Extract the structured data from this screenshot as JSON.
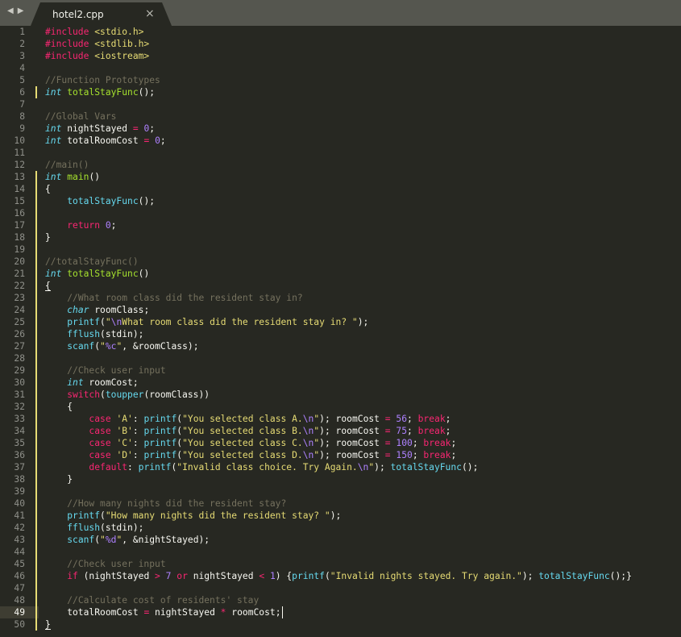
{
  "nav": {
    "back_icon": "left-triangle",
    "forward_icon": "right-triangle"
  },
  "tab": {
    "title": "hotel2.cpp",
    "close_glyph": "×"
  },
  "editor": {
    "cursor_line": 49,
    "modified_lines": [
      6,
      13,
      14,
      15,
      16,
      17,
      18,
      19,
      20,
      21,
      22,
      23,
      24,
      25,
      26,
      27,
      28,
      29,
      30,
      31,
      32,
      33,
      34,
      35,
      36,
      37,
      38,
      39,
      40,
      41,
      42,
      43,
      44,
      45,
      46,
      47,
      48,
      49,
      50
    ],
    "colors": {
      "background": "#272822",
      "tabbar": "#55564f",
      "foreground": "#f8f8f2",
      "keyword": "#f92672",
      "comment": "#75715e",
      "type": "#66d9ef",
      "function": "#a6e22e",
      "string": "#e6db74",
      "number": "#ae81ff"
    },
    "lines": [
      [
        [
          "pre",
          "#include "
        ],
        [
          "str",
          "<stdio.h>"
        ]
      ],
      [
        [
          "pre",
          "#include "
        ],
        [
          "str",
          "<stdlib.h>"
        ]
      ],
      [
        [
          "pre",
          "#include "
        ],
        [
          "str",
          "<iostream>"
        ]
      ],
      [],
      [
        [
          "com",
          "//Function Prototypes"
        ]
      ],
      [
        [
          "type",
          "int"
        ],
        [
          "op",
          " "
        ],
        [
          "fn",
          "totalStayFunc"
        ],
        [
          "op",
          "();"
        ]
      ],
      [],
      [
        [
          "com",
          "//Global Vars"
        ]
      ],
      [
        [
          "type",
          "int"
        ],
        [
          "op",
          " nightStayed "
        ],
        [
          "kw",
          "="
        ],
        [
          "op",
          " "
        ],
        [
          "num",
          "0"
        ],
        [
          "op",
          ";"
        ]
      ],
      [
        [
          "type",
          "int"
        ],
        [
          "op",
          " totalRoomCost "
        ],
        [
          "kw",
          "="
        ],
        [
          "op",
          " "
        ],
        [
          "num",
          "0"
        ],
        [
          "op",
          ";"
        ]
      ],
      [],
      [
        [
          "com",
          "//main()"
        ]
      ],
      [
        [
          "type",
          "int"
        ],
        [
          "op",
          " "
        ],
        [
          "fn",
          "main"
        ],
        [
          "op",
          "()"
        ]
      ],
      [
        [
          "op",
          "{"
        ]
      ],
      [
        [
          "op",
          "    "
        ],
        [
          "lib",
          "totalStayFunc"
        ],
        [
          "op",
          "();"
        ]
      ],
      [],
      [
        [
          "op",
          "    "
        ],
        [
          "kw",
          "return"
        ],
        [
          "op",
          " "
        ],
        [
          "num",
          "0"
        ],
        [
          "op",
          ";"
        ]
      ],
      [
        [
          "op",
          "}"
        ]
      ],
      [],
      [
        [
          "com",
          "//totalStayFunc()"
        ]
      ],
      [
        [
          "type",
          "int"
        ],
        [
          "op",
          " "
        ],
        [
          "fn",
          "totalStayFunc"
        ],
        [
          "op",
          "()"
        ]
      ],
      [
        [
          "op",
          "{"
        ]
      ],
      [
        [
          "op",
          "    "
        ],
        [
          "com",
          "//What room class did the resident stay in?"
        ]
      ],
      [
        [
          "op",
          "    "
        ],
        [
          "type",
          "char"
        ],
        [
          "op",
          " roomClass;"
        ]
      ],
      [
        [
          "op",
          "    "
        ],
        [
          "lib",
          "printf"
        ],
        [
          "op",
          "("
        ],
        [
          "str",
          "\""
        ],
        [
          "esc",
          "\\n"
        ],
        [
          "str",
          "What room class did the resident stay in? \""
        ],
        [
          "op",
          ");"
        ]
      ],
      [
        [
          "op",
          "    "
        ],
        [
          "lib",
          "fflush"
        ],
        [
          "op",
          "(stdin);"
        ]
      ],
      [
        [
          "op",
          "    "
        ],
        [
          "lib",
          "scanf"
        ],
        [
          "op",
          "("
        ],
        [
          "str",
          "\""
        ],
        [
          "esc",
          "%c"
        ],
        [
          "str",
          "\""
        ],
        [
          "op",
          ", &roomClass);"
        ]
      ],
      [],
      [
        [
          "op",
          "    "
        ],
        [
          "com",
          "//Check user input"
        ]
      ],
      [
        [
          "op",
          "    "
        ],
        [
          "type",
          "int"
        ],
        [
          "op",
          " roomCost;"
        ]
      ],
      [
        [
          "op",
          "    "
        ],
        [
          "kw",
          "switch"
        ],
        [
          "op",
          "("
        ],
        [
          "lib",
          "toupper"
        ],
        [
          "op",
          "(roomClass))"
        ]
      ],
      [
        [
          "op",
          "    {"
        ]
      ],
      [
        [
          "op",
          "        "
        ],
        [
          "kw",
          "case"
        ],
        [
          "op",
          " "
        ],
        [
          "str",
          "'A'"
        ],
        [
          "op",
          ": "
        ],
        [
          "lib",
          "printf"
        ],
        [
          "op",
          "("
        ],
        [
          "str",
          "\"You selected class A."
        ],
        [
          "esc",
          "\\n"
        ],
        [
          "str",
          "\""
        ],
        [
          "op",
          "); roomCost "
        ],
        [
          "kw",
          "="
        ],
        [
          "op",
          " "
        ],
        [
          "num",
          "56"
        ],
        [
          "op",
          "; "
        ],
        [
          "kw",
          "break"
        ],
        [
          "op",
          ";"
        ]
      ],
      [
        [
          "op",
          "        "
        ],
        [
          "kw",
          "case"
        ],
        [
          "op",
          " "
        ],
        [
          "str",
          "'B'"
        ],
        [
          "op",
          ": "
        ],
        [
          "lib",
          "printf"
        ],
        [
          "op",
          "("
        ],
        [
          "str",
          "\"You selected class B."
        ],
        [
          "esc",
          "\\n"
        ],
        [
          "str",
          "\""
        ],
        [
          "op",
          "); roomCost "
        ],
        [
          "kw",
          "="
        ],
        [
          "op",
          " "
        ],
        [
          "num",
          "75"
        ],
        [
          "op",
          "; "
        ],
        [
          "kw",
          "break"
        ],
        [
          "op",
          ";"
        ]
      ],
      [
        [
          "op",
          "        "
        ],
        [
          "kw",
          "case"
        ],
        [
          "op",
          " "
        ],
        [
          "str",
          "'C'"
        ],
        [
          "op",
          ": "
        ],
        [
          "lib",
          "printf"
        ],
        [
          "op",
          "("
        ],
        [
          "str",
          "\"You selected class C."
        ],
        [
          "esc",
          "\\n"
        ],
        [
          "str",
          "\""
        ],
        [
          "op",
          "); roomCost "
        ],
        [
          "kw",
          "="
        ],
        [
          "op",
          " "
        ],
        [
          "num",
          "100"
        ],
        [
          "op",
          "; "
        ],
        [
          "kw",
          "break"
        ],
        [
          "op",
          ";"
        ]
      ],
      [
        [
          "op",
          "        "
        ],
        [
          "kw",
          "case"
        ],
        [
          "op",
          " "
        ],
        [
          "str",
          "'D'"
        ],
        [
          "op",
          ": "
        ],
        [
          "lib",
          "printf"
        ],
        [
          "op",
          "("
        ],
        [
          "str",
          "\"You selected class D."
        ],
        [
          "esc",
          "\\n"
        ],
        [
          "str",
          "\""
        ],
        [
          "op",
          "); roomCost "
        ],
        [
          "kw",
          "="
        ],
        [
          "op",
          " "
        ],
        [
          "num",
          "150"
        ],
        [
          "op",
          "; "
        ],
        [
          "kw",
          "break"
        ],
        [
          "op",
          ";"
        ]
      ],
      [
        [
          "op",
          "        "
        ],
        [
          "kw",
          "default"
        ],
        [
          "op",
          ": "
        ],
        [
          "lib",
          "printf"
        ],
        [
          "op",
          "("
        ],
        [
          "str",
          "\"Invalid class choice. Try Again."
        ],
        [
          "esc",
          "\\n"
        ],
        [
          "str",
          "\""
        ],
        [
          "op",
          "); "
        ],
        [
          "lib",
          "totalStayFunc"
        ],
        [
          "op",
          "();"
        ]
      ],
      [
        [
          "op",
          "    }"
        ]
      ],
      [],
      [
        [
          "op",
          "    "
        ],
        [
          "com",
          "//How many nights did the resident stay?"
        ]
      ],
      [
        [
          "op",
          "    "
        ],
        [
          "lib",
          "printf"
        ],
        [
          "op",
          "("
        ],
        [
          "str",
          "\"How many nights did the resident stay? \""
        ],
        [
          "op",
          ");"
        ]
      ],
      [
        [
          "op",
          "    "
        ],
        [
          "lib",
          "fflush"
        ],
        [
          "op",
          "(stdin);"
        ]
      ],
      [
        [
          "op",
          "    "
        ],
        [
          "lib",
          "scanf"
        ],
        [
          "op",
          "("
        ],
        [
          "str",
          "\""
        ],
        [
          "esc",
          "%d"
        ],
        [
          "str",
          "\""
        ],
        [
          "op",
          ", &nightStayed);"
        ]
      ],
      [],
      [
        [
          "op",
          "    "
        ],
        [
          "com",
          "//Check user input"
        ]
      ],
      [
        [
          "op",
          "    "
        ],
        [
          "kw",
          "if"
        ],
        [
          "op",
          " (nightStayed "
        ],
        [
          "kw",
          ">"
        ],
        [
          "op",
          " "
        ],
        [
          "num",
          "7"
        ],
        [
          "op",
          " "
        ],
        [
          "kw",
          "or"
        ],
        [
          "op",
          " nightStayed "
        ],
        [
          "kw",
          "<"
        ],
        [
          "op",
          " "
        ],
        [
          "num",
          "1"
        ],
        [
          "op",
          ") {"
        ],
        [
          "lib",
          "printf"
        ],
        [
          "op",
          "("
        ],
        [
          "str",
          "\"Invalid nights stayed. Try again.\""
        ],
        [
          "op",
          "); "
        ],
        [
          "lib",
          "totalStayFunc"
        ],
        [
          "op",
          "();}"
        ]
      ],
      [],
      [
        [
          "op",
          "    "
        ],
        [
          "com",
          "//Calculate cost of residents' stay"
        ]
      ],
      [
        [
          "op",
          "    totalRoomCost "
        ],
        [
          "kw",
          "="
        ],
        [
          "op",
          " nightStayed "
        ],
        [
          "kw",
          "*"
        ],
        [
          "op",
          " roomCost;"
        ]
      ],
      [
        [
          "op",
          "}"
        ]
      ]
    ]
  }
}
